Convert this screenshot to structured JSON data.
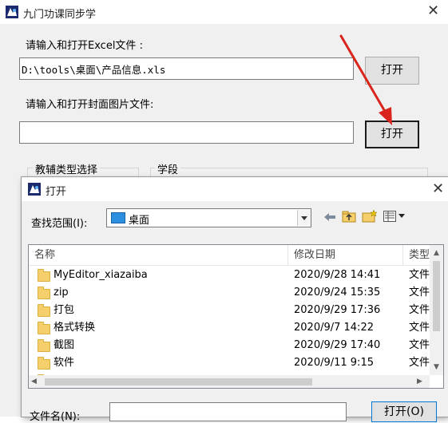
{
  "main": {
    "title": "九门功课同步学",
    "excel_label": "请输入和打开Excel文件 :",
    "excel_path": "D:\\tools\\桌面\\产品信息.xls",
    "open_label": "打开",
    "cover_label": "请输入和打开封面图片文件:",
    "cover_path": "",
    "group_type": "教辅类型选择",
    "group_stage": "学段"
  },
  "dialog": {
    "title": "打开",
    "lookin_label": "查找范围(I):",
    "lookin_value": "桌面",
    "columns": {
      "name": "名称",
      "date": "修改日期",
      "type": "类型"
    },
    "files": [
      {
        "name": "MyEditor_xiazaiba",
        "date": "2020/9/28 14:41",
        "type": "文件"
      },
      {
        "name": "zip",
        "date": "2020/9/24 15:35",
        "type": "文件"
      },
      {
        "name": "打包",
        "date": "2020/9/29 17:36",
        "type": "文件"
      },
      {
        "name": "格式转换",
        "date": "2020/9/7 14:22",
        "type": "文件"
      },
      {
        "name": "截图",
        "date": "2020/9/29 17:40",
        "type": "文件"
      },
      {
        "name": "软件",
        "date": "2020/9/11 9:15",
        "type": "文件"
      }
    ],
    "filename_label": "文件名(N):",
    "filename_value": "",
    "open_button": "打开(O)"
  },
  "colors": {
    "annotation_arrow": "#d9251c",
    "folder": "#f5cf6b"
  }
}
